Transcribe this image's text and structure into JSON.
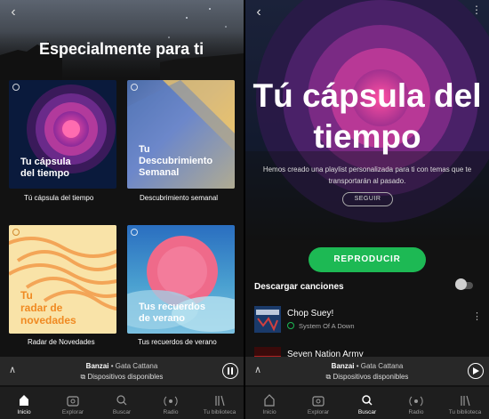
{
  "left": {
    "section_title": "Especialmente para ti",
    "cards": [
      {
        "text": "Tu cápsula\ndel tiempo",
        "caption": "Tú cápsula del tiempo"
      },
      {
        "text": "Tu\nDescubrimiento\nSemanal",
        "caption": "Descubrimiento semanal"
      },
      {
        "text": "Tu\nradar de\nnovedades",
        "caption": "Radar de Novedades"
      },
      {
        "text": "Tus recuerdos\nde verano",
        "caption": "Tus recuerdos de verano"
      }
    ]
  },
  "right": {
    "title": "Tú cápsula del\ntiempo",
    "description": "Hemos creado una playlist personalizada para ti con temas que te transportarán al pasado.",
    "follow_label": "SEGUIR",
    "play_label": "REPRODUCIR",
    "download_label": "Descargar canciones",
    "download_enabled": false,
    "tracks": [
      {
        "title": "Chop Suey!",
        "artist": "System Of A Down"
      },
      {
        "title": "Seven Nation Army",
        "artist": ""
      }
    ]
  },
  "player": {
    "song": "Banzai",
    "separator": " • ",
    "artist": "Gata Cattana",
    "devices": "Dispositivos disponibles"
  },
  "nav": [
    {
      "label": "Inicio",
      "icon": "home-icon"
    },
    {
      "label": "Explorar",
      "icon": "radio-browse-icon"
    },
    {
      "label": "Buscar",
      "icon": "search-icon"
    },
    {
      "label": "Radio",
      "icon": "radio-icon"
    },
    {
      "label": "Tu biblioteca",
      "icon": "library-icon"
    }
  ],
  "colors": {
    "accent": "#1db954",
    "background": "#121212",
    "player_bg": "#282828"
  }
}
